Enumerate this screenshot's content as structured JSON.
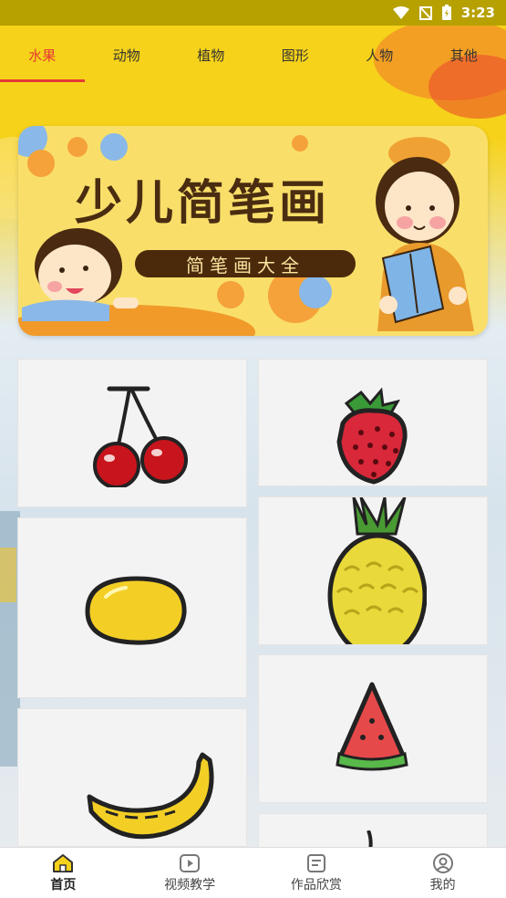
{
  "status_bar": {
    "time": "3:23"
  },
  "tabs": [
    {
      "label": "水果",
      "active": true
    },
    {
      "label": "动物",
      "active": false
    },
    {
      "label": "植物",
      "active": false
    },
    {
      "label": "图形",
      "active": false
    },
    {
      "label": "人物",
      "active": false
    },
    {
      "label": "其他",
      "active": false
    }
  ],
  "banner": {
    "title": "少儿简笔画",
    "subtitle": "简笔画大全"
  },
  "gallery": {
    "items": [
      {
        "icon": "cherry-icon"
      },
      {
        "icon": "strawberry-icon"
      },
      {
        "icon": "mango-icon"
      },
      {
        "icon": "pineapple-icon"
      },
      {
        "icon": "banana-icon"
      },
      {
        "icon": "watermelon-icon"
      }
    ]
  },
  "bottom_nav": [
    {
      "label": "首页",
      "icon": "home-icon",
      "active": true
    },
    {
      "label": "视频教学",
      "icon": "video-icon",
      "active": false
    },
    {
      "label": "作品欣赏",
      "icon": "gallery-icon",
      "active": false
    },
    {
      "label": "我的",
      "icon": "profile-icon",
      "active": false
    }
  ],
  "colors": {
    "accent": "#e53935",
    "tab_bar_bg": "#f6d21a",
    "banner_pill": "#4b2a0c"
  }
}
